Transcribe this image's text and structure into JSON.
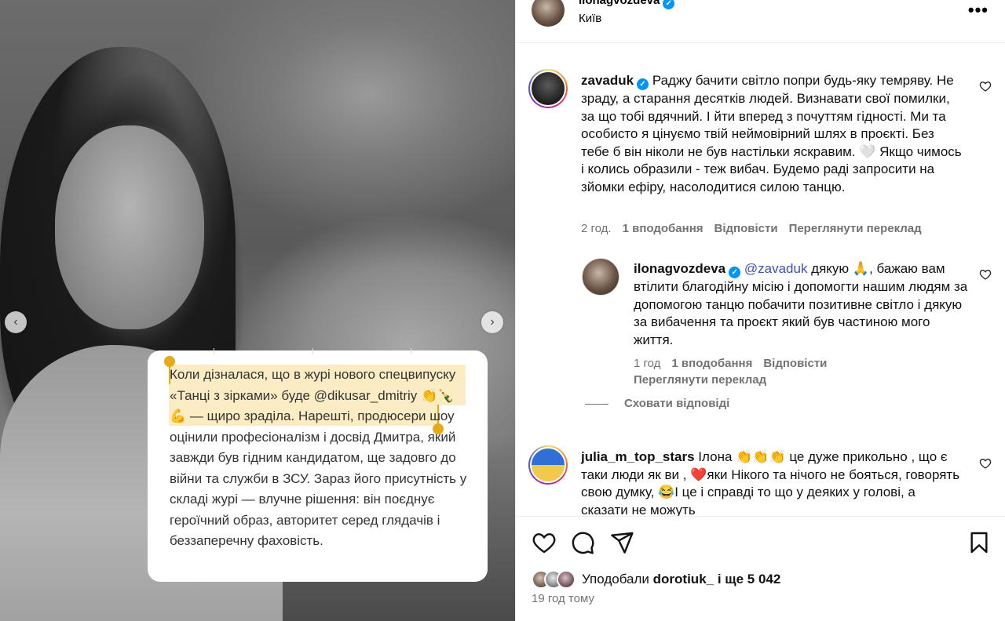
{
  "post": {
    "username": "ilonagvozdeva",
    "location": "Київ",
    "more_label": "•••"
  },
  "media": {
    "quote_text": "Коли дізналася, що в журі нового спецвипуску «Танці з зірками» буде @dikusar_dmitriy 👏🍾💪 — щиро зраділа. Нарешті, продюсери шоу оцінили професіоналізм і досвід Дмитра, який завжди був гідним кандидатом, ще задовго до війни та служби в ЗСУ. Зараз його присутність у складі журі — влучне рішення: він поєднує героїчний образ, авторитет серед глядачів і беззаперечну фаховість.",
    "prev_icon": "‹",
    "next_icon": "›"
  },
  "comments": [
    {
      "username": "zavaduk",
      "text": "Раджу бачити світло попри будь-яку темряву. Не зраду, а старання десятків людей. Визнавати свої помилки, за що тобі вдячний. І йти вперед з почуттям гідності. Ми та особисто я цінуємо твій неймовірний шлях в проєкті. Без тебе б він ніколи не був настільки яскравим. 🤍 Якщо чимось і колись образили - теж вибач. Будемо раді запросити на зйомки ефіру, насолодитися силою танцю.",
      "time": "2 год.",
      "likes": "1 вподобання",
      "reply": "Відповісти",
      "translate": "Переглянути переклад"
    },
    {
      "username": "ilonagvozdeva",
      "mention": "@zavaduk",
      "text": " дякую 🙏, бажаю вам втілити благодійну місію і допомогти нашим людям за допомогою танцю побачити позитивне світло і дякую за вибачення та проєкт який був частиною мого життя.",
      "time": "1 год",
      "likes": "1 вподобання",
      "reply": "Відповісти",
      "translate": "Переглянути переклад"
    },
    {
      "username": "julia_m_top_stars",
      "text": "Ілона 👏👏👏 це дуже прикольно , що є таки люди як ви , ❤️яки Нікого та нічого не бояться, говорять свою думку, 😂І це і справді то що у деяких у голові, а сказати не можуть"
    }
  ],
  "hide_replies": "Сховати відповіді",
  "footer": {
    "liked_by_prefix": "Уподобали",
    "liked_by_user": "dorotiuk_",
    "liked_by_suffix": "і ще 5 042",
    "post_time": "19 год тому"
  },
  "colors": {
    "verified": "#0095f6",
    "highlight": "#fbecc3",
    "selection_handle": "#e6a919",
    "mention": "#3f51b5",
    "muted": "#737373"
  }
}
